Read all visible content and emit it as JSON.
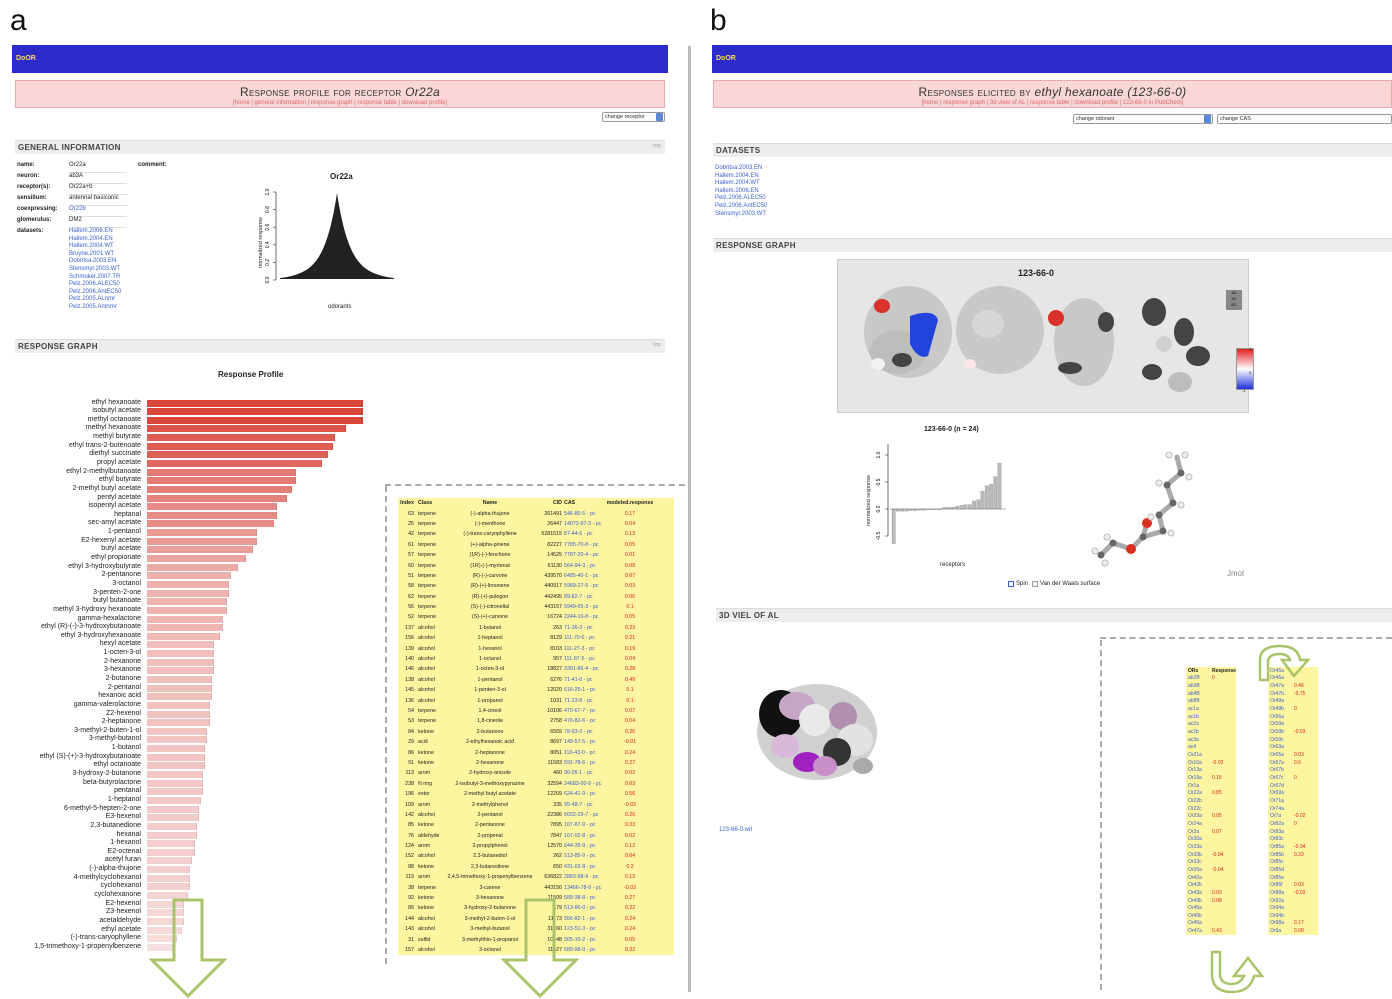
{
  "panels": {
    "a": "a",
    "b": "b"
  },
  "left": {
    "app_label": "DoOR",
    "title_prefix": "Response profile for receptor",
    "title_receptor": "Or22a",
    "nav": "[home | general information | response graph | response table | download profile]",
    "change_receptor": "change receptor",
    "general_info_header": "GENERAL INFORMATION",
    "top_label": "top",
    "info_rows": [
      {
        "k": "name:",
        "v": "Or22a"
      },
      {
        "k": "neuron:",
        "v": "ab3A"
      },
      {
        "k": "receptor(s):",
        "v": "Or22a+b"
      },
      {
        "k": "sensillum:",
        "v": "antennal basiconic"
      },
      {
        "k": "coexpressing:",
        "v": "Or22b"
      },
      {
        "k": "glomerulus:",
        "v": "DM2"
      },
      {
        "k": "datasets:",
        "v": ""
      }
    ],
    "comment_label": "comment:",
    "datasets": [
      "Hallem.2006.EN",
      "Hallem.2004.EN",
      "Hallem.2004.WT",
      "Bruyne.2001.WT",
      "Dobritsa.2003.EN",
      "Stensmyr.2003.WT",
      "Schmuker.2007.TR",
      "Pelz.2006.ALEC50",
      "Pelz.2006.AntEC50",
      "Pelz.2005.ALnmr",
      "Pelz.2005.Antnmr"
    ],
    "mini_chart": {
      "title": "Or22a",
      "xlabel": "odorants",
      "ylabel": "normalized response",
      "yticks": [
        "0.0",
        "0.2",
        "0.4",
        "0.6",
        "0.8",
        "1.0"
      ]
    },
    "response_graph_header": "RESPONSE GRAPH",
    "profile_title": "Response Profile",
    "table_headers": [
      "Index",
      "Class",
      "Name",
      "CID",
      "CAS",
      "modeled.response"
    ],
    "table_rows": [
      [
        "63",
        "terpene",
        "(-)-alpha-thujone",
        "261491",
        "546-80-5 - pc",
        "0.17"
      ],
      [
        "25",
        "terpene",
        "(-)-menthone",
        "26447",
        "14073-97-3 - pc",
        "0.04"
      ],
      [
        "42",
        "terpene",
        "(-)-trans-caryophyllene",
        "5281515",
        "87-44-5 - pc",
        "0.13"
      ],
      [
        "61",
        "terpene",
        "(+)-alpha-pinene",
        "82227",
        "7785-70-8 - pc",
        "0.05"
      ],
      [
        "57",
        "terpene",
        "(1R)-(-)-fenchone",
        "14525",
        "7787-20-4 - pc",
        "0.01"
      ],
      [
        "60",
        "terpene",
        "(1R)-(-)-myrtenal",
        "61130",
        "564-94-3 - pc",
        "0.08"
      ],
      [
        "51",
        "terpene",
        "(R)-(-)-carvone",
        "439570",
        "6485-40-1 - pc",
        "0.07"
      ],
      [
        "58",
        "terpene",
        "(R)-(+)-limonene",
        "440917",
        "5989-27-5 - pc",
        "0.03"
      ],
      [
        "62",
        "terpene",
        "(R)-(+)-pulegon",
        "442495",
        "89-82-7 - pc",
        "0.06"
      ],
      [
        "56",
        "terpene",
        "(S)-(-)-citronellal",
        "443157",
        "5949-05-3 - pc",
        "0.1"
      ],
      [
        "52",
        "terpene",
        "(S)-(+)-carvone",
        "16724",
        "2244-16-8 - pc",
        "0.05"
      ],
      [
        "137",
        "alcohol",
        "1-butanol",
        "263",
        "71-36-3 - pc",
        "0.23"
      ],
      [
        "156",
        "alcohol",
        "1-heptanol",
        "8129",
        "111-70-6 - pc",
        "0.21"
      ],
      [
        "139",
        "alcohol",
        "1-hexanol",
        "8103",
        "111-27-3 - pc",
        "0.19"
      ],
      [
        "140",
        "alcohol",
        "1-octanol",
        "957",
        "111-87-5 - pc",
        "0.04"
      ],
      [
        "146",
        "alcohol",
        "1-octen-3-ol",
        "18827",
        "3391-86-4 - pc",
        "0.28"
      ],
      [
        "138",
        "alcohol",
        "1-pentanol",
        "6276",
        "71-41-0 - pc",
        "0.49"
      ],
      [
        "145",
        "alcohol",
        "1-penten-3-ol",
        "12020",
        "616-25-1 - pc",
        "0.1"
      ],
      [
        "136",
        "alcohol",
        "1-propanol",
        "1031",
        "71-23-8 - pc",
        "0.1"
      ],
      [
        "54",
        "terpene",
        "1,4-cineol",
        "10106",
        "470-67-7 - pc",
        "0.07"
      ],
      [
        "53",
        "terpene",
        "1,8-cineole",
        "2758",
        "470-82-6 - pc",
        "0.04"
      ],
      [
        "84",
        "ketone",
        "2-butanone",
        "6569",
        "78-93-3 - pc",
        "0.26"
      ],
      [
        "29",
        "acid",
        "2-ethylhexanoic acid",
        "8697",
        "149-57-5 - pc",
        "-0.01"
      ],
      [
        "86",
        "ketone",
        "2-heptanone",
        "8051",
        "110-43-0 - pc",
        "0.24"
      ],
      [
        "91",
        "ketone",
        "2-hexanone",
        "11583",
        "591-78-6 - pc",
        "0.27"
      ],
      [
        "113",
        "arom",
        "2-hydroxy-anisole",
        "460",
        "90-05-1 - pc",
        "0.02"
      ],
      [
        "238",
        "N ring",
        "2-isobutyl-3-methoxypyrazine",
        "32594",
        "24683-00-9 - pc",
        "0.03"
      ],
      [
        "196",
        "ester",
        "2-methyl butyl acetate",
        "12209",
        "624-41-9 - pc",
        "0.56"
      ],
      [
        "109",
        "arom",
        "2-methylphenol",
        "335",
        "95-48-7 - pc",
        "-0.02"
      ],
      [
        "142",
        "alcohol",
        "2-pentanol",
        "22386",
        "6032-29-7 - pc",
        "0.26"
      ],
      [
        "85",
        "ketone",
        "2-pentanone",
        "7895",
        "107-87-9 - pc",
        "0.33"
      ],
      [
        "76",
        "aldehyde",
        "2-propenal",
        "7847",
        "107-02-8 - pc",
        "0.02"
      ],
      [
        "124",
        "arom",
        "2-propylphenol",
        "12570",
        "644-35-9 - pc",
        "0.12"
      ],
      [
        "152",
        "alcohol",
        "2,3-butanediol",
        "262",
        "513-85-9 - pc",
        "0.04"
      ],
      [
        "88",
        "ketone",
        "2,3-butanedione",
        "650",
        "431-03-8 - pc",
        "0.2"
      ],
      [
        "119",
        "arom",
        "2,4,5-trimethoxy-1-propenylbenzene",
        "636822",
        "2883-98-9 - pc",
        "0.13"
      ],
      [
        "38",
        "terpene",
        "3-carene",
        "443156",
        "13466-78-9 - pc",
        "-0.02"
      ],
      [
        "92",
        "ketone",
        "3-hexanone",
        "11509",
        "589-38-8 - pc",
        "0.27"
      ],
      [
        "89",
        "ketone",
        "3-hydroxy-2-butanone",
        "179",
        "513-86-0 - pc",
        "0.22"
      ],
      [
        "144",
        "alcohol",
        "3-methyl-2-buten-1-ol",
        "11173",
        "556-82-1 - pc",
        "0.24"
      ],
      [
        "143",
        "alcohol",
        "3-methyl-butanol",
        "31260",
        "123-51-3 - pc",
        "0.24"
      ],
      [
        "31",
        "sulfid",
        "3-methylthio-1-propanol",
        "10448",
        "505-10-2 - pc",
        "0.05"
      ],
      [
        "157",
        "alcohol",
        "3-octanol",
        "11527",
        "589-98-0 - pc",
        "0.32"
      ]
    ]
  },
  "chart_data": {
    "type": "bar",
    "title": "Response Profile",
    "orientation": "horizontal",
    "categories": [
      "ethyl hexanoate",
      "isobutyl acetate",
      "methyl octanoate",
      "methyl hexanoate",
      "methyl butyrate",
      "ethyl trans-2-butenoate",
      "diethyl succinate",
      "propyl acetate",
      "ethyl 2-methylbutanoate",
      "ethyl butyrate",
      "2-methyl butyl acetate",
      "pentyl acetate",
      "isopentyl acetate",
      "heptanal",
      "sec-amyl acetate",
      "1-pentanol",
      "E2-hexenyl acetate",
      "butyl acetate",
      "ethyl propionate",
      "ethyl 3-hydroxybutyrate",
      "2-pentanone",
      "3-octanol",
      "3-penten-2-one",
      "butyl butanoate",
      "methyl 3-hydroxy hexanoate",
      "gamma-hexalactone",
      "ethyl (R)-(-)-3-hydroxybutanoate",
      "ethyl 3-hydroxyhexanoate",
      "hexyl acetate",
      "1-octen-3-ol",
      "2-hexanone",
      "3-hexanone",
      "2-butanone",
      "2-pentanol",
      "hexanoic acid",
      "gamma-valerolactone",
      "Z2-hexenol",
      "2-heptanone",
      "3-methyl-2-buten-1-ol",
      "3-methyl-butanol",
      "1-butanol",
      "ethyl (S)-(+)-3-hydroxybutanoate",
      "ethyl octanoate",
      "3-hydroxy-2-butanone",
      "beta-butyrolactone",
      "pentanal",
      "1-heptanol",
      "6-methyl-5-hepten-2-one",
      "E3-hexenol",
      "2,3-butanedione",
      "hexanal",
      "1-hexanol",
      "E2-octenal",
      "acetyl furan",
      "(-)-alpha-thujone",
      "4-methylcyclohexanol",
      "cyclohexanol",
      "cyclohexanone",
      "E2-hexenol",
      "Z3-hexenol",
      "acetaldehyde",
      "ethyl acetate",
      "(-)-trans-caryophyllene",
      "1,5-trimethoxy-1-propenylbenzene"
    ],
    "values": [
      1.0,
      1.0,
      1.0,
      0.92,
      0.87,
      0.86,
      0.84,
      0.81,
      0.69,
      0.69,
      0.67,
      0.65,
      0.6,
      0.6,
      0.59,
      0.51,
      0.51,
      0.49,
      0.46,
      0.42,
      0.39,
      0.38,
      0.38,
      0.37,
      0.37,
      0.35,
      0.35,
      0.34,
      0.31,
      0.31,
      0.31,
      0.31,
      0.3,
      0.3,
      0.3,
      0.29,
      0.29,
      0.29,
      0.28,
      0.28,
      0.27,
      0.27,
      0.27,
      0.26,
      0.26,
      0.26,
      0.25,
      0.24,
      0.24,
      0.23,
      0.23,
      0.22,
      0.22,
      0.21,
      0.2,
      0.2,
      0.2,
      0.19,
      0.17,
      0.17,
      0.17,
      0.16,
      0.14,
      0.12
    ],
    "color_high": "#d9453a",
    "color_low": "#f7e3e3"
  },
  "right": {
    "app_label": "DoOR",
    "title_prefix": "Responses elicited by",
    "title_odorant": "ethyl hexanoate (123-66-0)",
    "nav": "[home | response graph | 3d view of AL | response table | download profile | 123-66-0 in PubChem]",
    "change_odorant": "change odorant",
    "change_cas": "change CAS",
    "datasets_header": "DATASETS",
    "datasets": [
      "Dobritsa.2003.EN",
      "Hallem.2004.EN",
      "Hallem.2004.WT",
      "Hallem.2006.EN",
      "Pelz.2006.ALEC50",
      "Pelz.2006.AntEC50",
      "Stensmyr.2003.WT"
    ],
    "response_graph_header": "RESPONSE GRAPH",
    "al_map_title": "123-66-0",
    "al_legend": [
      "NA",
      "SA",
      "BG"
    ],
    "scale_top": "1",
    "scale_mid": "0",
    "scale_bottom": "-1",
    "mini_chart": {
      "title": "123-66-0 (n = 24)",
      "xlabel": "receptors",
      "ylabel": "normalized response",
      "yticks": [
        "-0.5",
        "0.0",
        "0.5",
        "1.0"
      ]
    },
    "jmol_label": "Jmol",
    "spin_label": "Spin",
    "vdw_label": "Van der Waals surface",
    "al3d_header": "3D VIEL OF AL",
    "wrl_link": "123-66-0.wrl",
    "table_headers": [
      "ORs",
      "Response"
    ],
    "col1": [
      [
        "ab2B",
        "0"
      ],
      [
        "ab3B",
        ""
      ],
      [
        "ab4B",
        ""
      ],
      [
        "ab8B",
        ""
      ],
      [
        "ac1a",
        ""
      ],
      [
        "ac1b",
        ""
      ],
      [
        "ac2a",
        ""
      ],
      [
        "ac2b",
        ""
      ],
      [
        "ac3a",
        ""
      ],
      [
        "ac4",
        ""
      ],
      [
        "Or21a",
        ""
      ],
      [
        "Or10a",
        "-0.02"
      ],
      [
        "Or13a",
        ""
      ],
      [
        "Or19a",
        "0.15"
      ],
      [
        "Or1a",
        ""
      ],
      [
        "Or22a",
        "0.85"
      ],
      [
        "Or22b",
        ""
      ],
      [
        "Or22c",
        ""
      ],
      [
        "Or23a",
        "0.05"
      ],
      [
        "Or24a",
        ""
      ],
      [
        "Or2a",
        "0.07"
      ],
      [
        "Or30a",
        ""
      ],
      [
        "Or33a",
        ""
      ],
      [
        "Or33b",
        "-0.04"
      ],
      [
        "Or33c",
        ""
      ],
      [
        "Or35a",
        "-0.04"
      ],
      [
        "Or42a",
        ""
      ],
      [
        "Or42b",
        ""
      ],
      [
        "Or43a",
        "0.03"
      ],
      [
        "Or43b",
        "0.08"
      ],
      [
        "Or45a",
        ""
      ],
      [
        "Or45b",
        ""
      ],
      [
        "Or46a",
        ""
      ],
      [
        "Or47a",
        "0.43"
      ]
    ],
    "col2": [
      [
        "Or45a",
        ""
      ],
      [
        "Or46a",
        ""
      ],
      [
        "Or47a",
        "0.46"
      ],
      [
        "Or47b",
        "-0.75"
      ],
      [
        "Or49a",
        ""
      ],
      [
        "Or49b",
        "0"
      ],
      [
        "Or56a",
        ""
      ],
      [
        "Or59a",
        ""
      ],
      [
        "Or59b",
        "-0.03"
      ],
      [
        "Or59c",
        ""
      ],
      [
        "Or63a",
        ""
      ],
      [
        "Or65a",
        "0.03"
      ],
      [
        "Or67a",
        "0.6"
      ],
      [
        "Or67b",
        ""
      ],
      [
        "Or67c",
        "0"
      ],
      [
        "Or67d",
        ""
      ],
      [
        "Or69a",
        ""
      ],
      [
        "Or71a",
        ""
      ],
      [
        "Or74a",
        ""
      ],
      [
        "Or7a",
        "-0.02"
      ],
      [
        "Or82a",
        "0"
      ],
      [
        "Or83a",
        ""
      ],
      [
        "Or83c",
        ""
      ],
      [
        "Or85a",
        "-0.04"
      ],
      [
        "Or85b",
        "0.33"
      ],
      [
        "Or85c",
        ""
      ],
      [
        "Or85d",
        ""
      ],
      [
        "Or85e",
        ""
      ],
      [
        "Or85f",
        "0.03"
      ],
      [
        "Or88a",
        "-0.03"
      ],
      [
        "Or92a",
        ""
      ],
      [
        "Or94a",
        ""
      ],
      [
        "Or94b",
        ""
      ],
      [
        "Or98a",
        "0.17"
      ],
      [
        "Or9a",
        "0.08"
      ]
    ]
  }
}
